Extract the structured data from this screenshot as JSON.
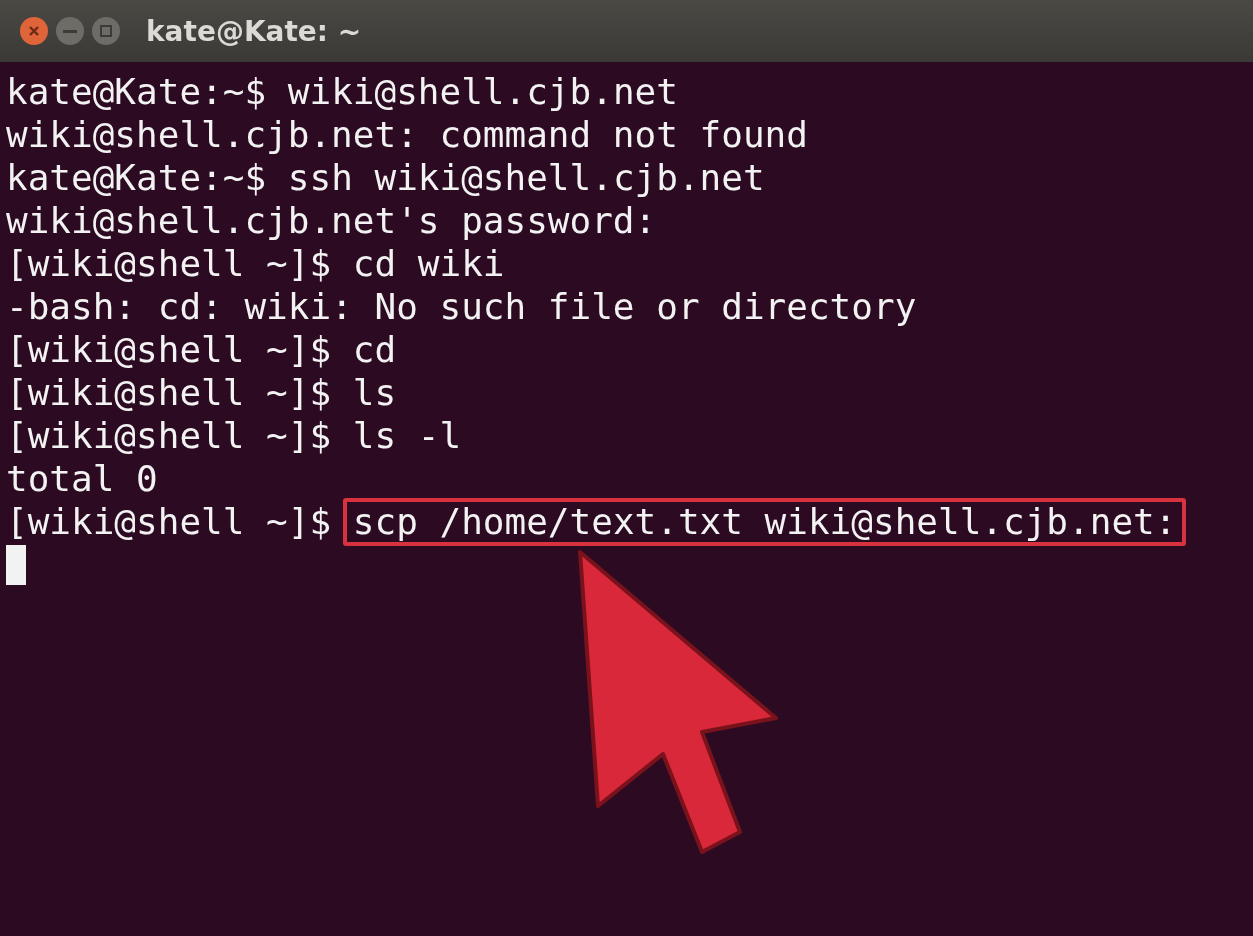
{
  "window": {
    "title": "kate@Kate: ~"
  },
  "lines": [
    {
      "kind": "prompt",
      "prompt": "kate@Kate:~$",
      "command": "wiki@shell.cjb.net",
      "highlighted": false
    },
    {
      "kind": "output",
      "text": "wiki@shell.cjb.net: command not found"
    },
    {
      "kind": "prompt",
      "prompt": "kate@Kate:~$",
      "command": "ssh wiki@shell.cjb.net",
      "highlighted": false
    },
    {
      "kind": "output",
      "text": "wiki@shell.cjb.net's password:"
    },
    {
      "kind": "prompt",
      "prompt": "[wiki@shell ~]$",
      "command": "cd wiki",
      "highlighted": false
    },
    {
      "kind": "output",
      "text": "-bash: cd: wiki: No such file or directory"
    },
    {
      "kind": "prompt",
      "prompt": "[wiki@shell ~]$",
      "command": "cd",
      "highlighted": false
    },
    {
      "kind": "prompt",
      "prompt": "[wiki@shell ~]$",
      "command": "ls",
      "highlighted": false
    },
    {
      "kind": "prompt",
      "prompt": "[wiki@shell ~]$",
      "command": "ls -l",
      "highlighted": false
    },
    {
      "kind": "output",
      "text": "total 0"
    },
    {
      "kind": "prompt",
      "prompt": "[wiki@shell ~]$",
      "command": "scp /home/text.txt wiki@shell.cjb.net:",
      "highlighted": true
    },
    {
      "kind": "cursor"
    }
  ]
}
